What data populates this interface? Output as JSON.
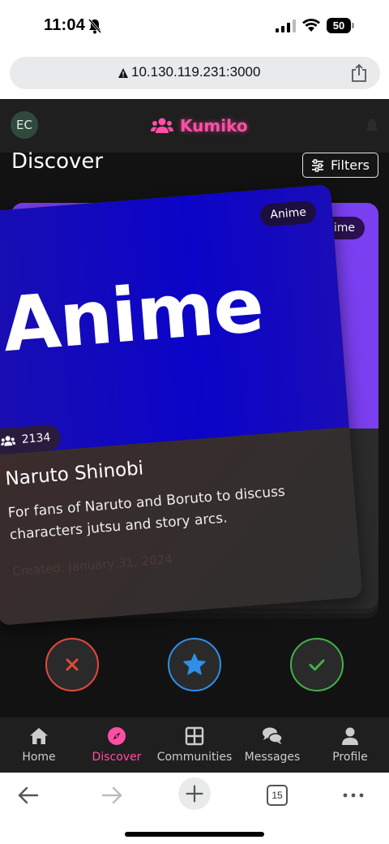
{
  "status_bar": {
    "time": "11:04",
    "battery": "50",
    "battery_level": 0.5
  },
  "browser": {
    "url": "10.130.119.231:3000",
    "tab_count": "15"
  },
  "header": {
    "avatar_initials": "EC",
    "brand_name": "Kumiko",
    "brand_color": "#ff4fa5"
  },
  "page": {
    "title": "Discover",
    "filters_label": "Filters"
  },
  "card_back": {
    "tag": "Anime"
  },
  "card": {
    "hero_text": "Anime",
    "tag": "Anime",
    "member_count": "2134",
    "name": "Naruto Shinobi",
    "description": "For fans of Naruto and Boruto to discuss characters jutsu and story arcs.",
    "created": "Created: January 31, 2024",
    "hero_color": "#0b04c8"
  },
  "actions": {
    "reject_icon": "close-icon",
    "favorite_icon": "star-icon",
    "accept_icon": "check-icon"
  },
  "nav": [
    {
      "label": "Home",
      "icon": "home-icon"
    },
    {
      "label": "Discover",
      "icon": "compass-icon",
      "active": true
    },
    {
      "label": "Communities",
      "icon": "grid-icon"
    },
    {
      "label": "Messages",
      "icon": "comments-icon"
    },
    {
      "label": "Profile",
      "icon": "user-icon"
    }
  ]
}
